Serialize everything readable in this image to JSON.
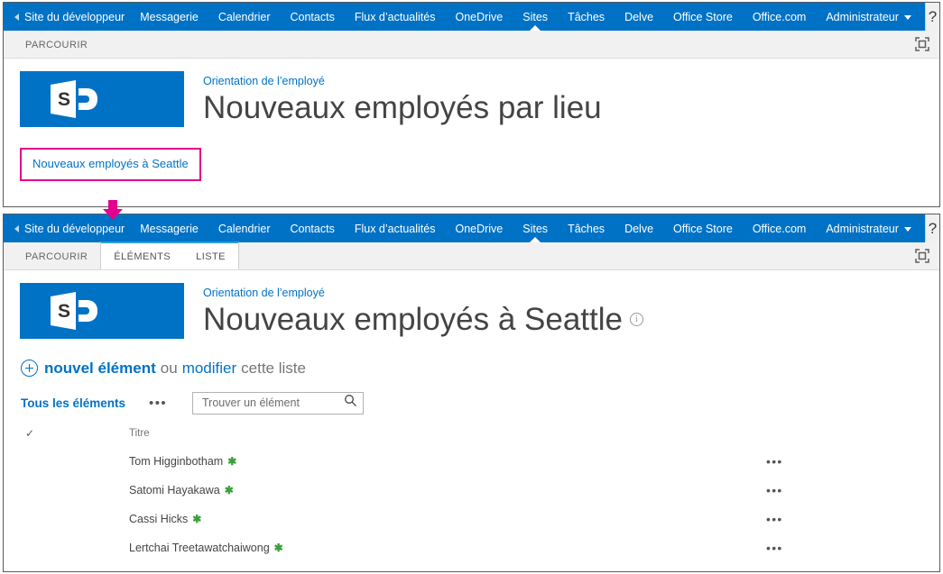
{
  "suite_nav": {
    "site_name": "Site du développeur",
    "back_icon": "back-triangle-icon",
    "links": [
      {
        "label": "Messagerie",
        "active": false
      },
      {
        "label": "Calendrier",
        "active": false
      },
      {
        "label": "Contacts",
        "active": false
      },
      {
        "label": "Flux d’actualités",
        "active": false
      },
      {
        "label": "OneDrive",
        "active": false
      },
      {
        "label": "Sites",
        "active": true
      },
      {
        "label": "Tâches",
        "active": false
      },
      {
        "label": "Delve",
        "active": false
      },
      {
        "label": "Office Store",
        "active": false
      },
      {
        "label": "Office.com",
        "active": false
      }
    ],
    "account_label": "Administrateur",
    "help_label": "?",
    "bar_color": "#0072c6"
  },
  "top_panel": {
    "ribbon": {
      "tabs": [
        {
          "label": "PARCOURIR",
          "grouped": false
        }
      ],
      "focus_icon": "focus-on-content-icon"
    },
    "logo": {
      "name": "sharepoint-logo",
      "letter": "S",
      "color": "#0072c6"
    },
    "breadcrumb": "Orientation de l’employé",
    "title": "Nouveaux employés par lieu",
    "callout": {
      "link_label": "Nouveaux employés à Seattle",
      "border_color": "#e3008c"
    }
  },
  "annotation": {
    "arrow_color": "#e3008c",
    "arrow_icon": "down-arrow-annotation"
  },
  "bottom_panel": {
    "ribbon": {
      "tabs": [
        {
          "label": "PARCOURIR",
          "grouped": false
        },
        {
          "label": "ÉLÉMENTS",
          "grouped": true
        },
        {
          "label": "LISTE",
          "grouped": true
        }
      ],
      "focus_icon": "focus-on-content-icon"
    },
    "logo": {
      "name": "sharepoint-logo",
      "letter": "S",
      "color": "#0072c6"
    },
    "breadcrumb": "Orientation de l’employé",
    "title": "Nouveaux employés à Seattle",
    "title_info_icon": "info-icon",
    "commands": {
      "new_item": "nouvel élément",
      "or": "ou",
      "edit": "modifier",
      "this_list": "cette liste",
      "plus_icon": "plus-circle-icon"
    },
    "view": {
      "current": "Tous les éléments",
      "more_icon": "ellipsis-icon"
    },
    "search": {
      "placeholder": "Trouver un élément",
      "value": "",
      "icon": "search-icon"
    },
    "list": {
      "header_check_icon": "checkmark-icon",
      "columns": [
        "Titre"
      ],
      "rows": [
        {
          "title": "Tom Higginbotham",
          "badge": "new-item-icon",
          "menu": "ellipsis-icon"
        },
        {
          "title": "Satomi Hayakawa",
          "badge": "new-item-icon",
          "menu": "ellipsis-icon"
        },
        {
          "title": "Cassi Hicks",
          "badge": "new-item-icon",
          "menu": "ellipsis-icon"
        },
        {
          "title": "Lertchai Treetawatchaiwong",
          "badge": "new-item-icon",
          "menu": "ellipsis-icon"
        }
      ],
      "badge_glyph": "✱",
      "menu_glyph": "•••",
      "check_glyph": "✓"
    }
  }
}
